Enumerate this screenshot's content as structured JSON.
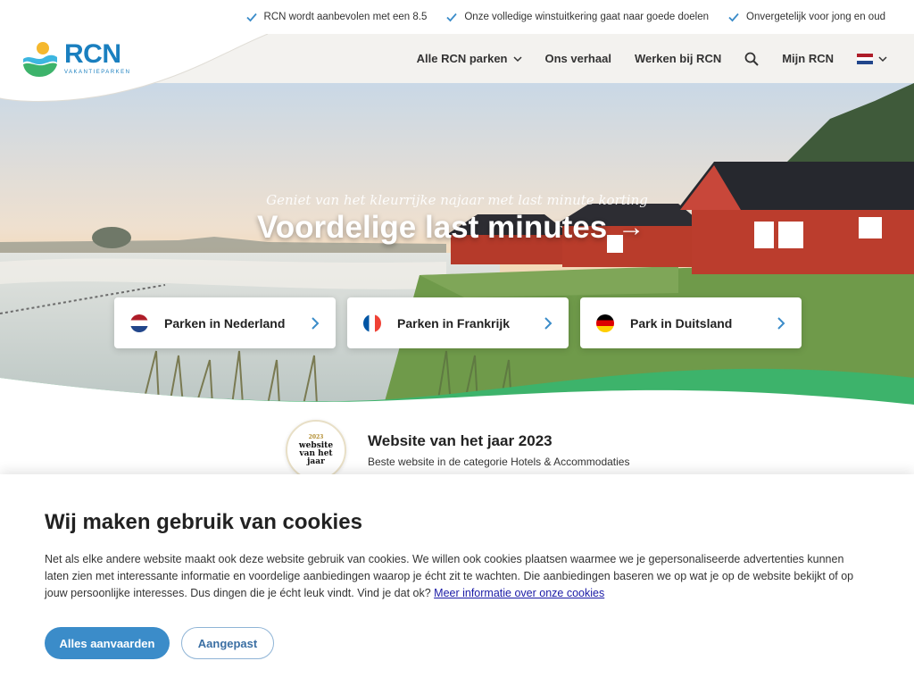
{
  "topbar": {
    "usps": [
      "RCN wordt aanbevolen met een 8.5",
      "Onze volledige winstuitkering gaat naar goede doelen",
      "Onvergetelijk voor jong en oud"
    ]
  },
  "logo": {
    "name": "RCN",
    "tagline": "VAKANTIEPARKEN"
  },
  "menu": {
    "parks": "Alle RCN parken",
    "story": "Ons verhaal",
    "jobs": "Werken bij RCN",
    "account": "Mijn RCN"
  },
  "hero": {
    "subtitle": "Geniet van het kleurrijke najaar met last minute korting",
    "title": "Voordelige last minutes",
    "cards": [
      {
        "label": "Parken in Nederland",
        "flag": "nl"
      },
      {
        "label": "Parken in Frankrijk",
        "flag": "fr"
      },
      {
        "label": "Park in Duitsland",
        "flag": "de"
      }
    ]
  },
  "award": {
    "badge_year": "2023",
    "badge_line1": "website",
    "badge_line2": "van het",
    "badge_line3": "jaar",
    "title": "Website van het jaar 2023",
    "description": "Beste website in de categorie Hotels & Accommodaties"
  },
  "cookie": {
    "title": "Wij maken gebruik van cookies",
    "text": "Net als elke andere website maakt ook deze website gebruik van cookies. We willen ook cookies plaatsen waarmee we je gepersonaliseerde advertenties kunnen laten zien met interessante informatie en voordelige aanbiedingen waarop je écht zit te wachten. Die aanbiedingen baseren we op wat je op de website bekijkt of op jouw persoonlijke interesses. Dus dingen die je écht leuk vindt. Vind je dat ok?",
    "link": "Meer informatie over onze cookies",
    "accept": "Alles aanvaarden",
    "custom": "Aangepast"
  },
  "colors": {
    "brand_blue": "#1a7fbf",
    "brand_green": "#3db36b",
    "brand_yellow": "#f5b82e",
    "button_blue": "#3b8cc9"
  }
}
